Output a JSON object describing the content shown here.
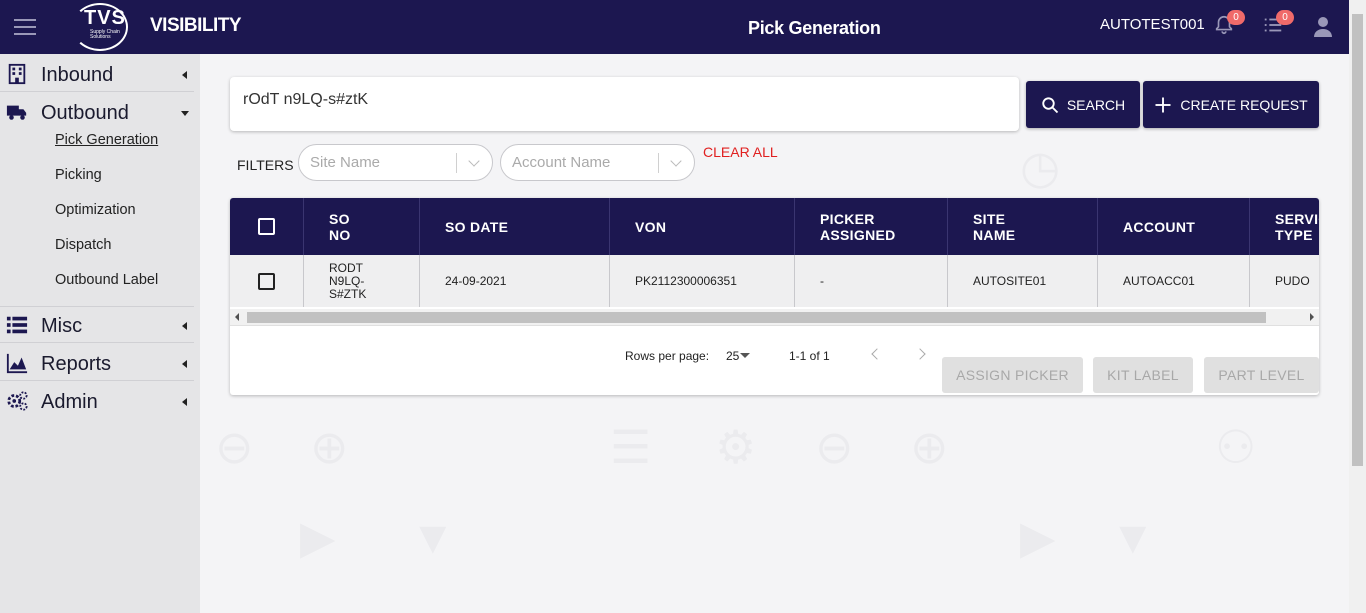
{
  "header": {
    "app_name": "VISIBILITY",
    "logo_text": "TVS",
    "logo_sub": "Supply Chain Solutions",
    "page_title": "Pick Generation",
    "user": "AUTOTEST001",
    "notifications_count": "0",
    "tasks_count": "0"
  },
  "sidebar": {
    "groups": [
      {
        "label": "Inbound",
        "icon": "building-icon"
      },
      {
        "label": "Outbound",
        "icon": "truck-icon"
      },
      {
        "label": "Misc",
        "icon": "list-icon"
      },
      {
        "label": "Reports",
        "icon": "area-chart-icon"
      },
      {
        "label": "Admin",
        "icon": "gears-icon"
      }
    ],
    "outbound_items": [
      "Pick Generation",
      "Picking",
      "Optimization",
      "Dispatch",
      "Outbound Label"
    ]
  },
  "search": {
    "value": "rOdT n9LQ-s#ztK",
    "search_label": "SEARCH",
    "create_label": "CREATE REQUEST"
  },
  "filters": {
    "label": "FILTERS",
    "site_placeholder": "Site Name",
    "account_placeholder": "Account Name",
    "clear_all": "CLEAR ALL"
  },
  "table": {
    "columns": [
      "SO NO",
      "SO DATE",
      "VON",
      "PICKER ASSIGNED",
      "SITE NAME",
      "ACCOUNT",
      "SERVICE TYPE"
    ],
    "col_header_lines": {
      "so_no": [
        "SO",
        "NO"
      ],
      "so_date": "SO DATE",
      "von": "VON",
      "picker": [
        "PICKER",
        "ASSIGNED"
      ],
      "site": [
        "SITE",
        "NAME"
      ],
      "account": "ACCOUNT",
      "service": [
        "SERVICE",
        "TYPE"
      ]
    },
    "rows": [
      {
        "so_no": [
          "RODT",
          "N9LQ-",
          "S#ZTK"
        ],
        "so_date": "24-09-2021",
        "von": "PK2112300006351",
        "picker": "-",
        "site": "AUTOSITE01",
        "account": "AUTOACC01",
        "service": "PUDO"
      }
    ]
  },
  "pagination": {
    "rows_per_page_label": "Rows per page:",
    "rows_per_page": "25",
    "range": "1-1 of 1"
  },
  "actions": {
    "assign_picker": "ASSIGN PICKER",
    "kit_label": "KIT LABEL",
    "part_level": "PART LEVEL"
  },
  "colors": {
    "brand": "#1c1750",
    "clear_all": "#e02020",
    "badge": "#f06a6a"
  }
}
